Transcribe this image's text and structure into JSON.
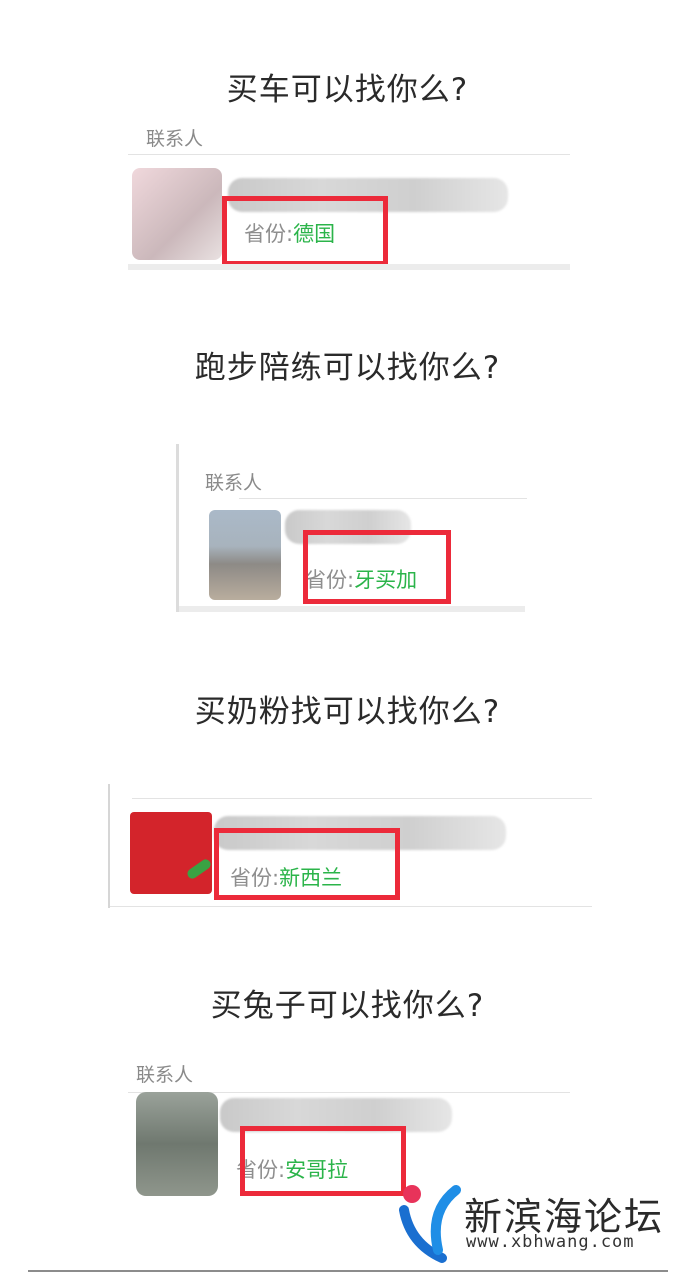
{
  "colors": {
    "highlight_red": "#ec2a3a",
    "province_green": "#2bb44a",
    "label_gray": "#8a8a8a"
  },
  "sections": [
    {
      "question": "买车可以找你么?",
      "contact_label": "联系人",
      "province_label": "省份:",
      "province_value": "德国"
    },
    {
      "question": "跑步陪练可以找你么?",
      "contact_label": "联系人",
      "province_label": "省份:",
      "province_value": "牙买加"
    },
    {
      "question": "买奶粉找可以找你么?",
      "province_label": "省份:",
      "province_value": "新西兰"
    },
    {
      "question": "买兔子可以找你么?",
      "contact_label": "联系人",
      "province_label": "省份:",
      "province_value": "安哥拉"
    }
  ],
  "watermark": {
    "name": "新滨海论坛",
    "url": "www.xbhwang.com",
    "icon": "xinbinhai-logo-icon"
  }
}
